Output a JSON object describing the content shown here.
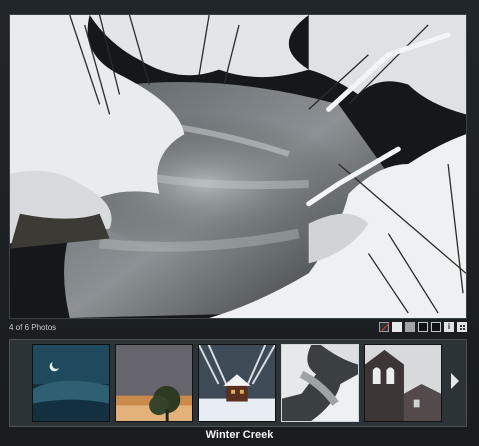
{
  "gallery": {
    "counter_text": "4 of 6 Photos",
    "caption": "Winter Creek",
    "controls": [
      {
        "name": "bg-none-icon",
        "style": "none"
      },
      {
        "name": "bg-white-icon",
        "style": "light"
      },
      {
        "name": "bg-gray-icon",
        "style": "mid"
      },
      {
        "name": "bg-black-icon",
        "style": "dark"
      },
      {
        "name": "bg-dark-icon",
        "style": "dark"
      },
      {
        "name": "info-icon",
        "style": "info"
      },
      {
        "name": "grid-view-icon",
        "style": "grid"
      }
    ],
    "info_glyph": "i",
    "thumbnails": [
      {
        "name": "thumb-moon-night"
      },
      {
        "name": "thumb-sunset-tree"
      },
      {
        "name": "thumb-snow-cabin"
      },
      {
        "name": "thumb-winter-creek",
        "active": true
      },
      {
        "name": "thumb-church-tower"
      }
    ],
    "next_arrow": "next-arrow-icon"
  }
}
